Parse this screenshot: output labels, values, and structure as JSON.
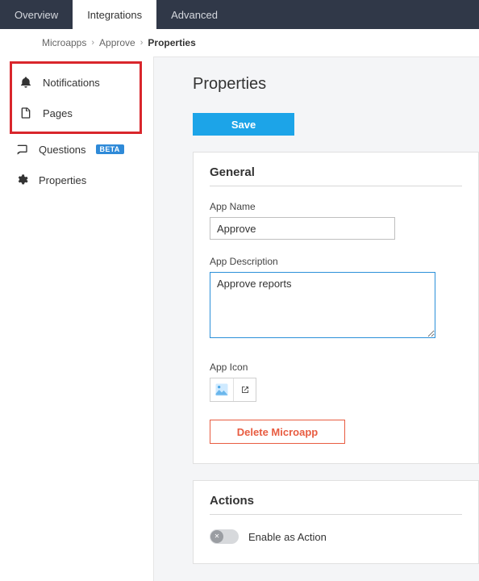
{
  "tabs": {
    "overview": "Overview",
    "integrations": "Integrations",
    "advanced": "Advanced",
    "active": "integrations"
  },
  "breadcrumb": {
    "microapps": "Microapps",
    "approve": "Approve",
    "current": "Properties"
  },
  "sidebar": {
    "notifications": "Notifications",
    "pages": "Pages",
    "questions": "Questions",
    "questions_badge": "BETA",
    "properties": "Properties"
  },
  "page": {
    "title": "Properties",
    "save": "Save"
  },
  "general": {
    "heading": "General",
    "app_name_label": "App Name",
    "app_name_value": "Approve",
    "app_desc_label": "App Description",
    "app_desc_value": "Approve reports",
    "app_icon_label": "App Icon",
    "delete_label": "Delete Microapp"
  },
  "actions": {
    "heading": "Actions",
    "enable_label": "Enable as Action",
    "enabled": false
  }
}
